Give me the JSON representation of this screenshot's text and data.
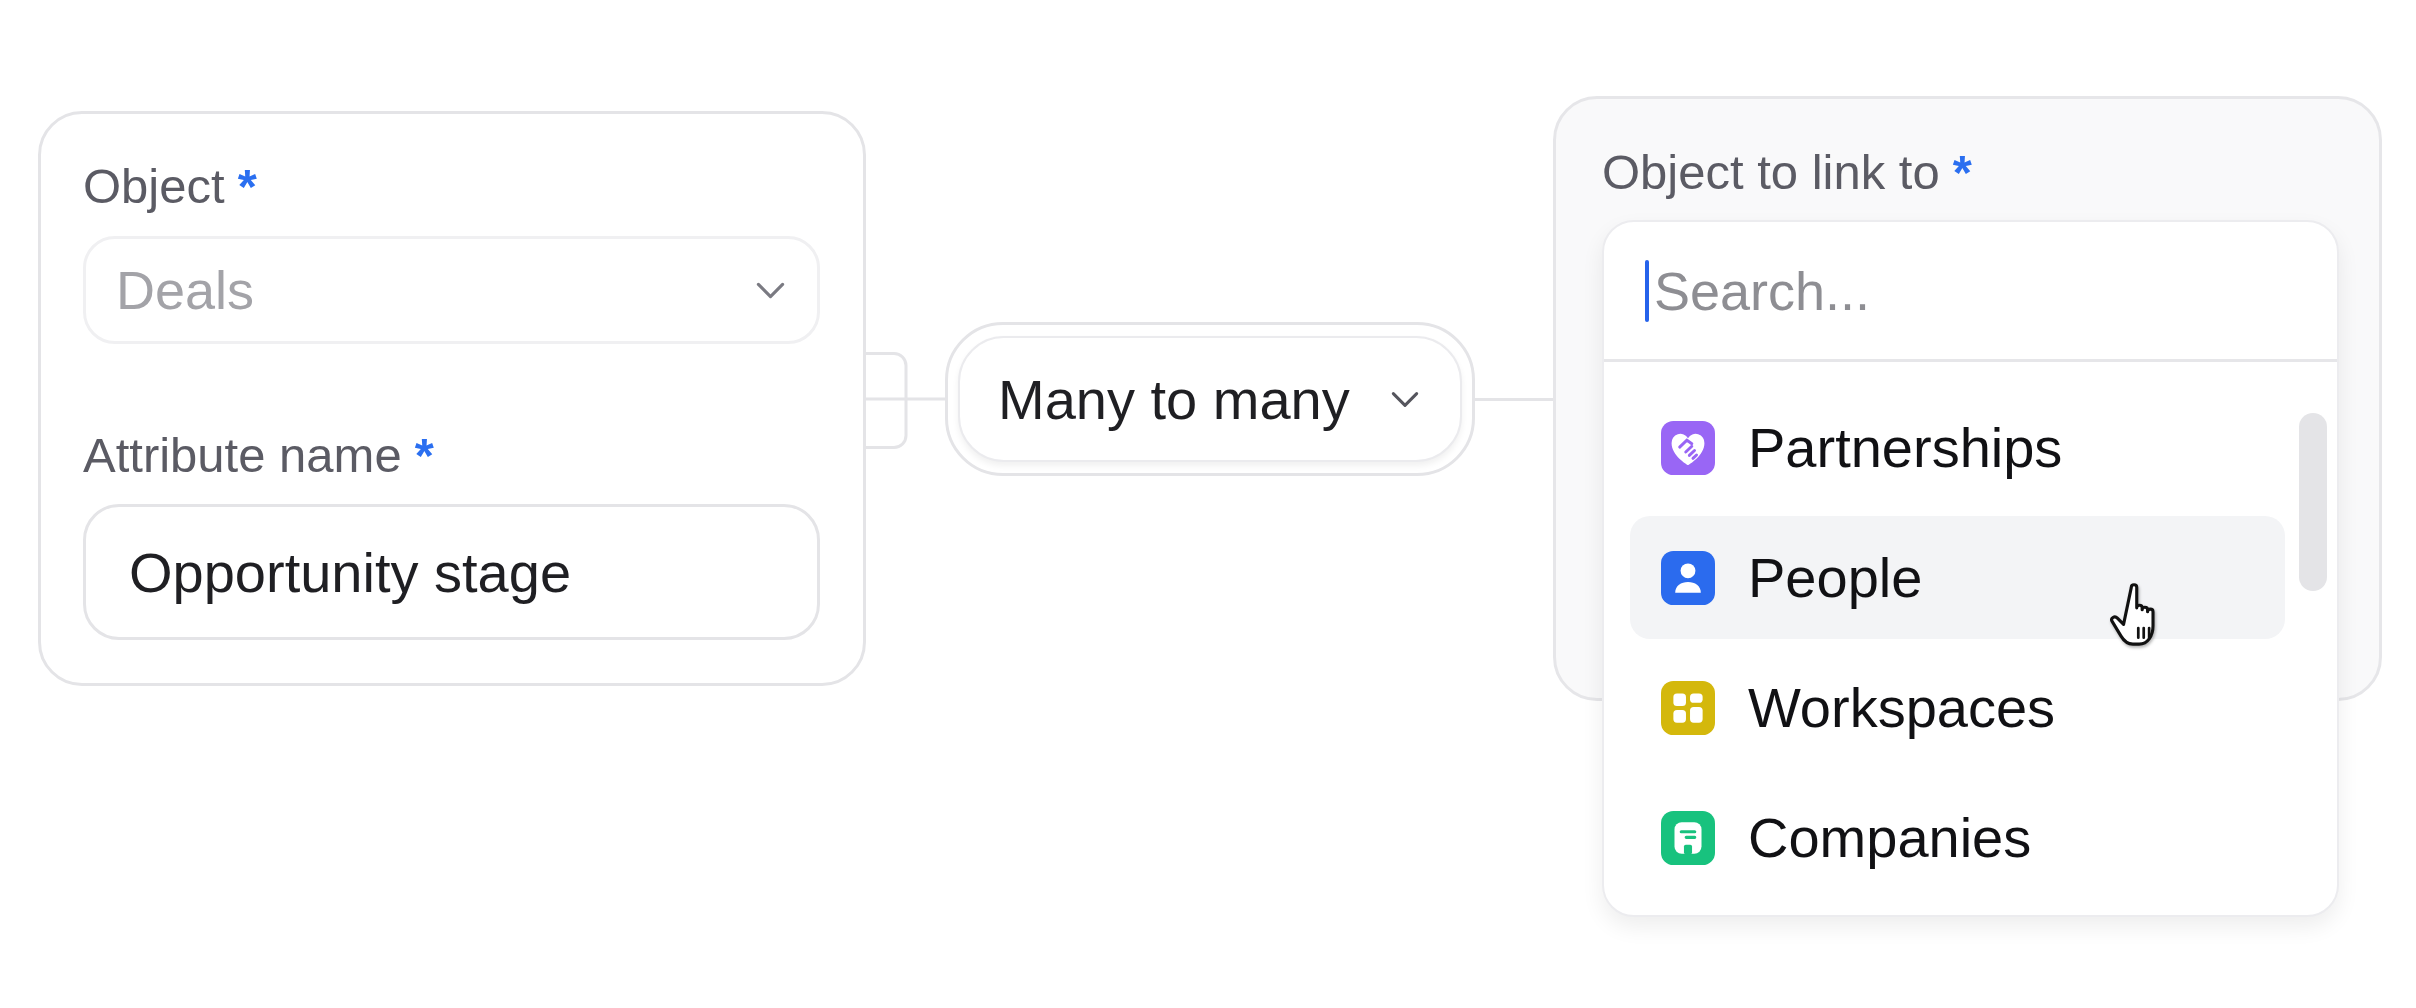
{
  "source": {
    "fields": [
      {
        "kind": "select",
        "label": "Object",
        "required_mark": "*",
        "value": "Deals",
        "disabled": true
      },
      {
        "kind": "text",
        "label": "Attribute name",
        "required_mark": "*",
        "value": "Opportunity stage",
        "disabled": false
      }
    ]
  },
  "relationship": {
    "value": "Many to many"
  },
  "target": {
    "label": "Object to link to",
    "required_mark": "*",
    "search": {
      "placeholder": "Search...",
      "focused": true
    },
    "options": [
      {
        "label": "Partnerships",
        "color": "#9966f5",
        "selected": false
      },
      {
        "label": "People",
        "color": "#2b6bee",
        "selected": true
      },
      {
        "label": "Workspaces",
        "color": "#d4b80c",
        "selected": false
      },
      {
        "label": "Companies",
        "color": "#18c27e",
        "selected": false
      }
    ]
  }
}
